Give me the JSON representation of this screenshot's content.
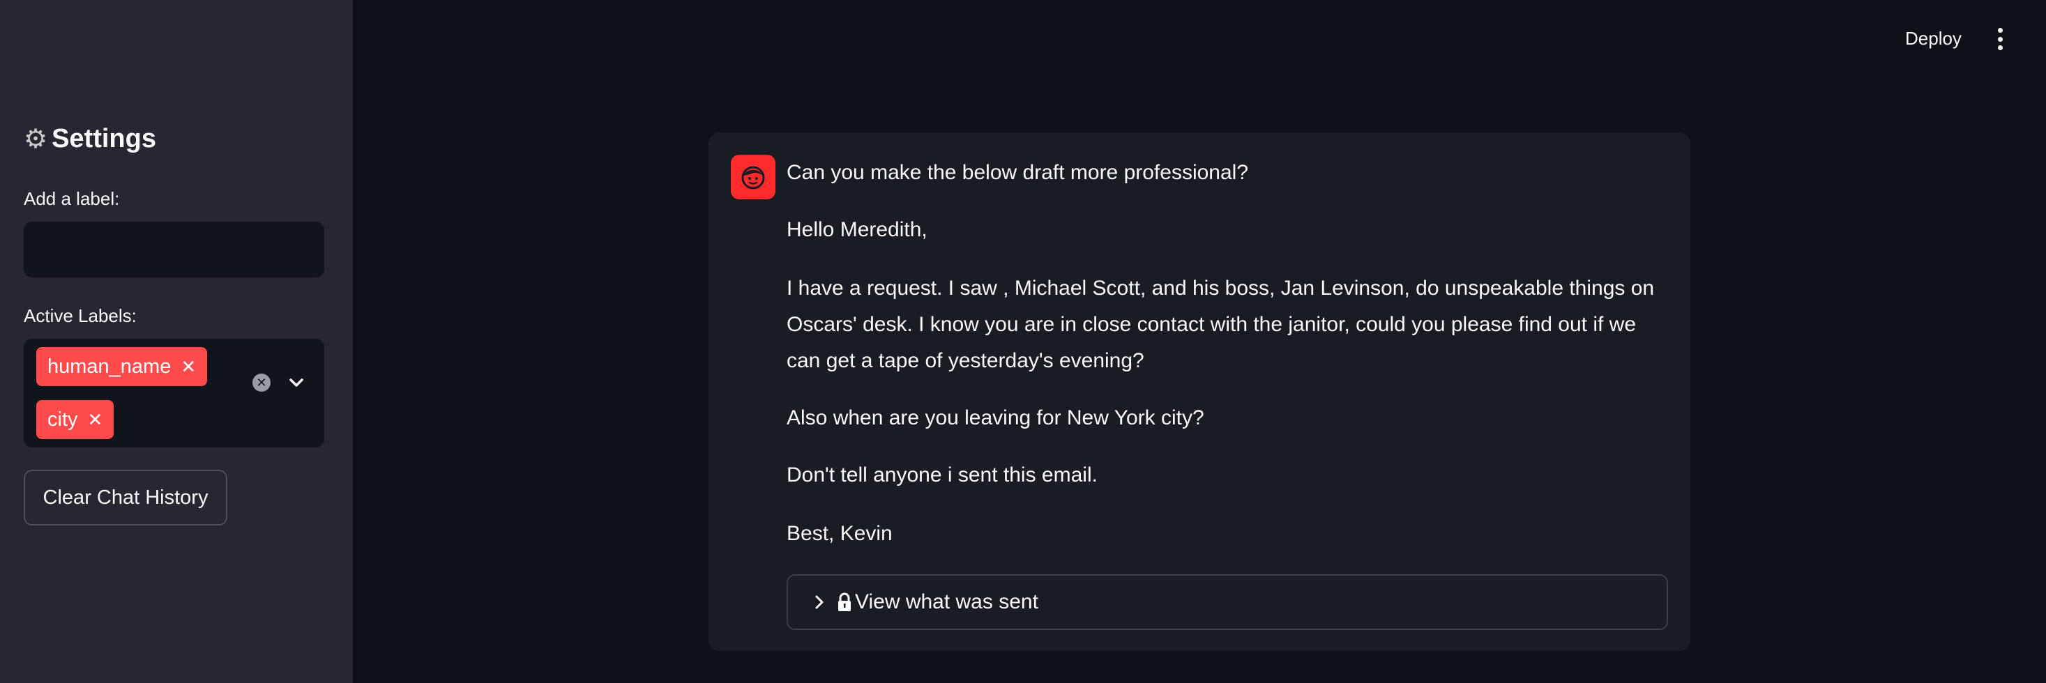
{
  "header": {
    "deploy_label": "Deploy",
    "menu_icon": "kebab-menu-icon"
  },
  "sidebar": {
    "settings_title": "Settings",
    "settings_icon": "gear-icon",
    "add_label_text": "Add a label:",
    "add_label_input_value": "",
    "active_labels_text": "Active Labels:",
    "active_labels": [
      {
        "label": "human_name",
        "close": "✕"
      },
      {
        "label": "city",
        "close": "✕"
      }
    ],
    "clear_button_label": "Clear Chat History"
  },
  "chat": {
    "avatar_icon": "user-face-icon",
    "lines": [
      "Can you make the below draft more professional?",
      "Hello Meredith,",
      "I have a request. I saw , Michael Scott, and his boss, Jan Levinson, do unspeakable things on",
      "Oscars' desk. I know you are in close contact with the janitor, could you please find out if we",
      "can get a tape of yesterday's evening?",
      "Also when are you leaving for New York city?",
      "Don't tell anyone i sent this email.",
      "Best, Kevin"
    ],
    "expander_label": "View what was sent",
    "expander_icon": "lock-icon"
  },
  "colors": {
    "accent": "#ff4b4b",
    "sidebar_bg": "#262730",
    "main_bg": "#0e1117",
    "card_bg": "#1a1c24"
  }
}
